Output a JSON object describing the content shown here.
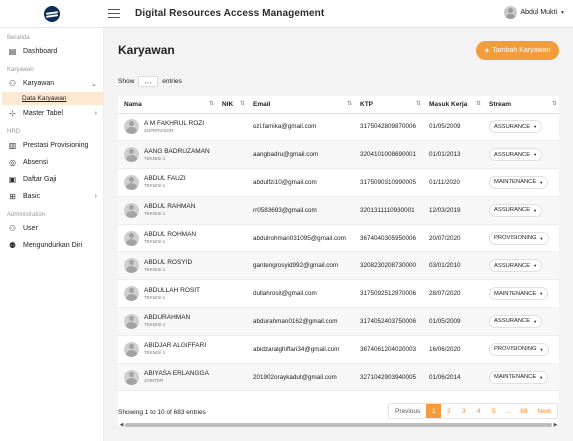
{
  "header": {
    "title": "Digital Resources Access Management",
    "user_name": "Abdul Mukti"
  },
  "sidebar": {
    "sections": [
      "Beranda",
      "Karyawan",
      "HRD",
      "Administration"
    ],
    "items": {
      "dashboard": "Dashboard",
      "karyawan": "Karyawan",
      "data_karyawan": "Data Karyawan",
      "master_tabel": "Master Tabel",
      "prestasi": "Prestasi Provisioning",
      "absensi": "Absensi",
      "daftar_gaji": "Daftar Gaji",
      "basic": "Basic",
      "user": "User",
      "mengundurkan": "Mengundurkan Diri"
    }
  },
  "main": {
    "title": "Karyawan",
    "add_button": "Tambah Karyawan",
    "show_label": "Show",
    "entries_label": "entries",
    "show_value": ",, ,",
    "columns": [
      "Nama",
      "NIK",
      "Email",
      "KTP",
      "Masuk Kerja",
      "Stream"
    ],
    "rows": [
      {
        "name": "A M FAKHRUL ROZI",
        "role": "SUPERVISOR",
        "nik": "",
        "email": "ozi.famika@gmail.com",
        "ktp": "3175042809870006",
        "masuk": "01/05/2009",
        "stream": "ASSURANCE"
      },
      {
        "name": "AANG BADRUZAMAN",
        "role": "TEKNISI 1",
        "nik": "",
        "email": "aangbadru@gmail.com",
        "ktp": "3204101008690001",
        "masuk": "01/01/2013",
        "stream": "ASSURANCE"
      },
      {
        "name": "ABDUL FAUZI",
        "role": "TEKNISI 1",
        "nik": "",
        "email": "abdulfzi10@gmail.com",
        "ktp": "3175090310990005",
        "masuk": "01/11/2020",
        "stream": "MAINTENANCE"
      },
      {
        "name": "ABDUL RAHMAN",
        "role": "TEKNISI 1",
        "nik": "",
        "email": "rr0583693@gmail.com",
        "ktp": "3201311110930001",
        "masuk": "12/03/2019",
        "stream": "ASSURANCE"
      },
      {
        "name": "ABDUL ROHMAN",
        "role": "TEKNISI 1",
        "nik": "",
        "email": "abdulrohman031095@gmail.com",
        "ktp": "3674040305950006",
        "masuk": "20/07/2020",
        "stream": "PROVISIONING"
      },
      {
        "name": "ABDUL ROSYID",
        "role": "TEKNISI 1",
        "nik": "",
        "email": "gantengrosyid992@gmail.com",
        "ktp": "3208230208730000",
        "masuk": "03/01/2010",
        "stream": "ASSURANCE"
      },
      {
        "name": "ABDULLAH ROSIT",
        "role": "TEKNISI 1",
        "nik": "",
        "email": "dullahrosit@gmail.com",
        "ktp": "3175092512970006",
        "masuk": "28/07/2020",
        "stream": "MAINTENANCE"
      },
      {
        "name": "ABDURAHMAN",
        "role": "TEKNISI 1",
        "nik": "",
        "email": "abdurahman0162@gmail.com",
        "ktp": "3174052403750006",
        "masuk": "01/05/2009",
        "stream": "ASSURANCE"
      },
      {
        "name": "ABIDJAR ALGIFFARI",
        "role": "TEKNISI 1",
        "nik": "",
        "email": "abidzaralghiffari34@gmail.com",
        "ktp": "3674061204020003",
        "masuk": "16/06/2020",
        "stream": "PROVISIONING"
      },
      {
        "name": "ABIYASA ERLANGGA",
        "role": "JOINTER",
        "nik": "",
        "email": "201902oraykadut@gmail.com",
        "ktp": "3271042903940005",
        "masuk": "01/06/2014",
        "stream": "MAINTENANCE"
      }
    ],
    "showing_text": "Showing 1 to 10 of 683 entries",
    "pagination": {
      "prev": "Previous",
      "pages": [
        "1",
        "2",
        "3",
        "4",
        "5",
        "...",
        "69"
      ],
      "next": "Next",
      "active": "1"
    }
  }
}
